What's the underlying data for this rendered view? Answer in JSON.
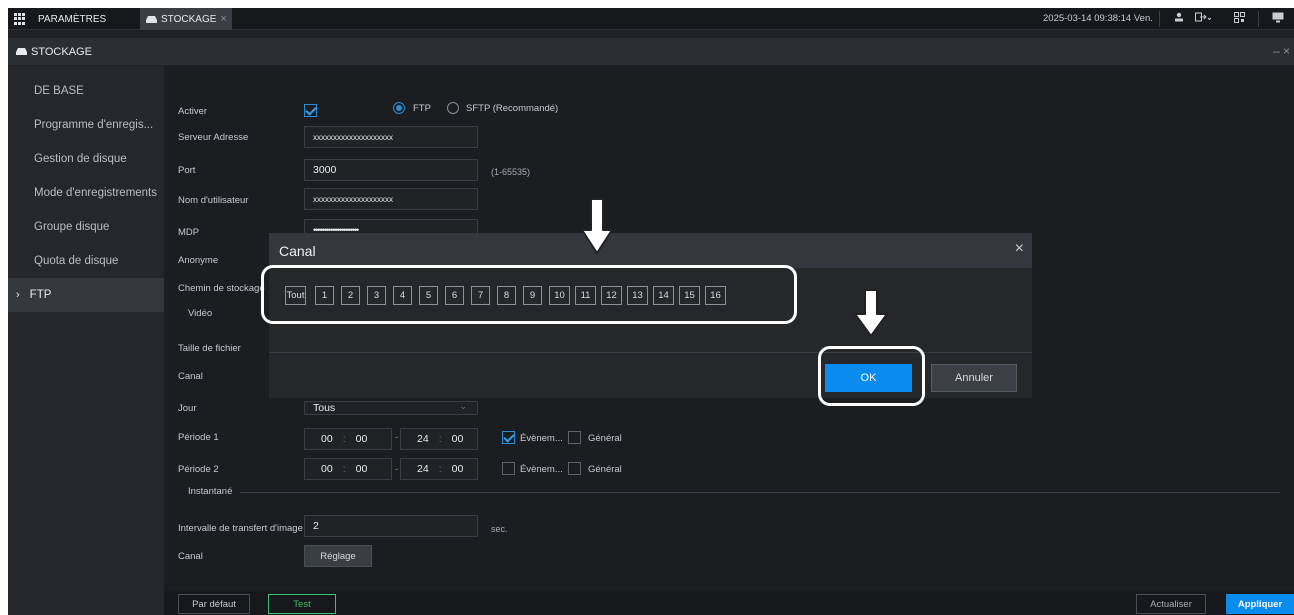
{
  "topbar": {
    "tab_params": "PARAMÈTRES",
    "tab_storage": "STOCKAGE",
    "tab_close": "×",
    "datetime": "2025-03-14 09:38:14 Ven."
  },
  "title": {
    "label": "STOCKAGE",
    "controls": "– ×"
  },
  "sidebar": {
    "items": [
      {
        "label": "DE BASE"
      },
      {
        "label": "Programme d'enregis..."
      },
      {
        "label": "Gestion de disque"
      },
      {
        "label": "Mode d'enregistrements"
      },
      {
        "label": "Groupe disque"
      },
      {
        "label": "Quota de disque"
      },
      {
        "label": "FTP",
        "chevron": "›"
      }
    ]
  },
  "form": {
    "enable_label": "Activer",
    "ftp_label": "FTP",
    "sftp_label": "SFTP (Recommandé)",
    "server_label": "Serveur Adresse",
    "server_value": "xxxxxxxxxxxxxxxxxxxx",
    "port_label": "Port",
    "port_value": "3000",
    "port_hint": "(1-65535)",
    "user_label": "Nom d'utilisateur",
    "user_value": "xxxxxxxxxxxxxxxxxxxx",
    "pwd_label": "MDP",
    "pwd_value": "•••••••••••••••••••••",
    "anon_label": "Anonyme",
    "path_label": "Chemin de stockage",
    "video_section": "Vidéo",
    "filesize_label": "Taille de fichier",
    "channel_label": "Canal",
    "day_label": "Jour",
    "day_value": "Tous",
    "period1_label": "Période 1",
    "period2_label": "Période 2",
    "p1": {
      "h1": "00",
      "m1": "00",
      "h2": "24",
      "m2": "00",
      "event": "Évènem...",
      "general": "Général"
    },
    "p2": {
      "h1": "00",
      "m1": "00",
      "h2": "24",
      "m2": "00",
      "event": "Évènem...",
      "general": "Général"
    },
    "snapshot_section": "Instantané",
    "interval_label": "Intervalle de transfert d'image",
    "interval_value": "2",
    "interval_unit": "sec.",
    "channel2_label": "Canal",
    "setting_button": "Réglage"
  },
  "bottom": {
    "default_button": "Par défaut",
    "test_button": "Test",
    "refresh_button": "Actualiser",
    "apply_button": "Appliquer"
  },
  "dialog": {
    "title": "Canal",
    "close": "×",
    "channels": [
      "Tout",
      "1",
      "2",
      "3",
      "4",
      "5",
      "6",
      "7",
      "8",
      "9",
      "10",
      "11",
      "12",
      "13",
      "14",
      "15",
      "16"
    ],
    "ok_button": "OK",
    "cancel_button": "Annuler"
  },
  "colors": {
    "accent": "#0a8cef",
    "test_green": "#3fbf6f",
    "background": "#1e2024"
  }
}
